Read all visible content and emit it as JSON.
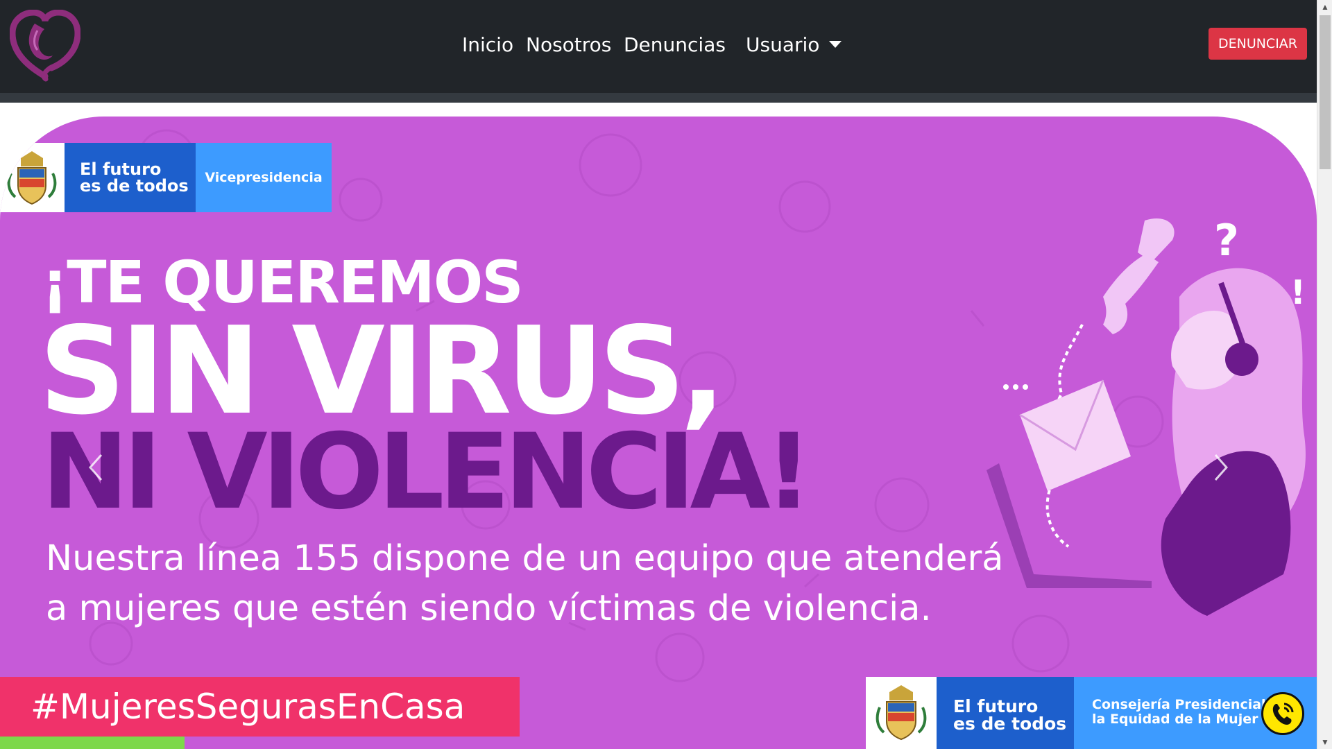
{
  "navbar": {
    "logo_icon": "heart-woman-logo-icon",
    "links": {
      "inicio": "Inicio",
      "nosotros": "Nosotros",
      "denuncias": "Denuncias",
      "usuario": "Usuario"
    },
    "cta_label": "DENUNCIAR",
    "cta_color": "#dc3545",
    "bg_color": "#212529"
  },
  "banner": {
    "bg_color": "#c65ad8",
    "gov_top": {
      "line1": "El futuro",
      "line2": "es de todos",
      "right_label": "Vicepresidencia"
    },
    "headline_1": "¡TE QUEREMOS",
    "headline_2": "SIN VIRUS,",
    "headline_3": "NI VIOLENCIA!",
    "body_line_1": "Nuestra línea 155 dispone de un equipo que atenderá",
    "body_line_2": "a mujeres que estén siendo víctimas de violencia.",
    "hashtag": "#MujeresSegurasEnCasa",
    "gov_bottom": {
      "line1": "El futuro",
      "line2": "es de todos",
      "right_line1": "Consejería Presidencial",
      "right_line2": "la Equidad de la Mujer"
    }
  },
  "scrollbar": {
    "up": "▲",
    "down": "▼"
  }
}
